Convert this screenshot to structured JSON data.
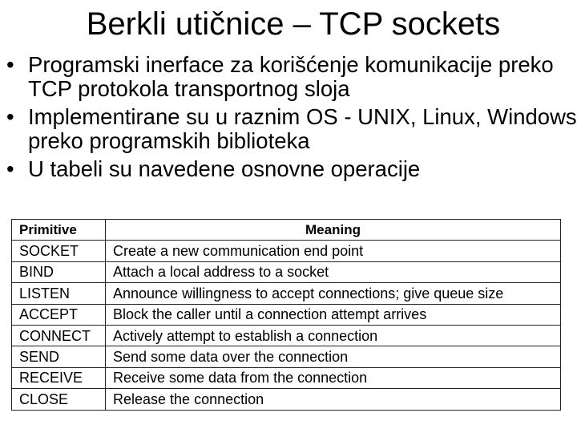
{
  "slide": {
    "title": "Berkli utičnice – TCP sockets",
    "bullets": [
      {
        "symbol": "•",
        "text": "Programski inerface za korišćenje komunikacije preko TCP protokola transportnog sloja"
      },
      {
        "symbol": "•",
        "text": "Implementirane su u raznim OS - UNIX, Linux, Windows preko programskih biblioteka"
      },
      {
        "symbol": "•",
        "text": "U tabeli su navedene osnovne operacije"
      }
    ]
  },
  "table": {
    "headers": [
      "Primitive",
      "Meaning"
    ],
    "rows": [
      [
        "SOCKET",
        "Create a new communication end point"
      ],
      [
        "BIND",
        "Attach a local address to a socket"
      ],
      [
        "LISTEN",
        "Announce willingness to accept connections; give queue size"
      ],
      [
        "ACCEPT",
        "Block the caller until a connection attempt arrives"
      ],
      [
        "CONNECT",
        "Actively attempt to establish a connection"
      ],
      [
        "SEND",
        "Send some data over the connection"
      ],
      [
        "RECEIVE",
        "Receive some data from the connection"
      ],
      [
        "CLOSE",
        "Release the connection"
      ]
    ]
  }
}
